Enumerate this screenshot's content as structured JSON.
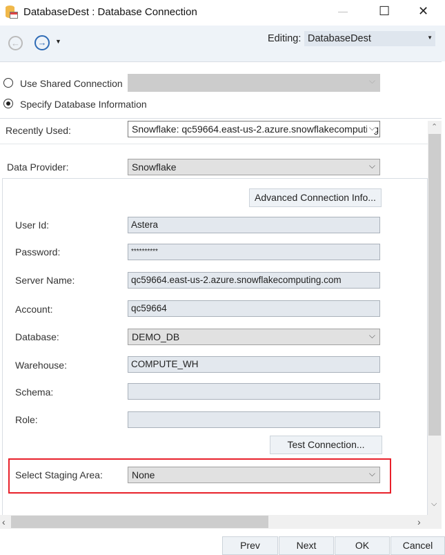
{
  "window": {
    "title": "DatabaseDest : Database Connection",
    "minimize": "—",
    "maximize": "☐",
    "close": "✕"
  },
  "toolbar": {
    "editing_label": "Editing:",
    "editing_value": "DatabaseDest"
  },
  "connection_mode": {
    "shared_label": "Use Shared Connection",
    "shared_value": "",
    "specify_label": "Specify Database Information",
    "selected": "specify"
  },
  "recently_used": {
    "label": "Recently Used:",
    "value": "Snowflake: qc59664.east-us-2.azure.snowflakecomputing"
  },
  "data_provider": {
    "label": "Data Provider:",
    "value": "Snowflake"
  },
  "advanced_button": "Advanced Connection Info...",
  "fields": {
    "user_id": {
      "label": "User Id:",
      "value": "Astera"
    },
    "password": {
      "label": "Password:",
      "value": "**********"
    },
    "server_name": {
      "label": "Server Name:",
      "value": "qc59664.east-us-2.azure.snowflakecomputing.com"
    },
    "account": {
      "label": "Account:",
      "value": "qc59664"
    },
    "database": {
      "label": "Database:",
      "value": "DEMO_DB"
    },
    "warehouse": {
      "label": "Warehouse:",
      "value": "COMPUTE_WH"
    },
    "schema": {
      "label": "Schema:",
      "value": ""
    },
    "role": {
      "label": "Role:",
      "value": ""
    }
  },
  "test_button": "Test Connection...",
  "staging": {
    "label": "Select Staging Area:",
    "value": "None"
  },
  "footer": {
    "prev": "Prev",
    "next": "Next",
    "ok": "OK",
    "cancel": "Cancel"
  },
  "colors": {
    "highlight": "#e8202a",
    "toolbar_bg": "#eef3f8"
  }
}
